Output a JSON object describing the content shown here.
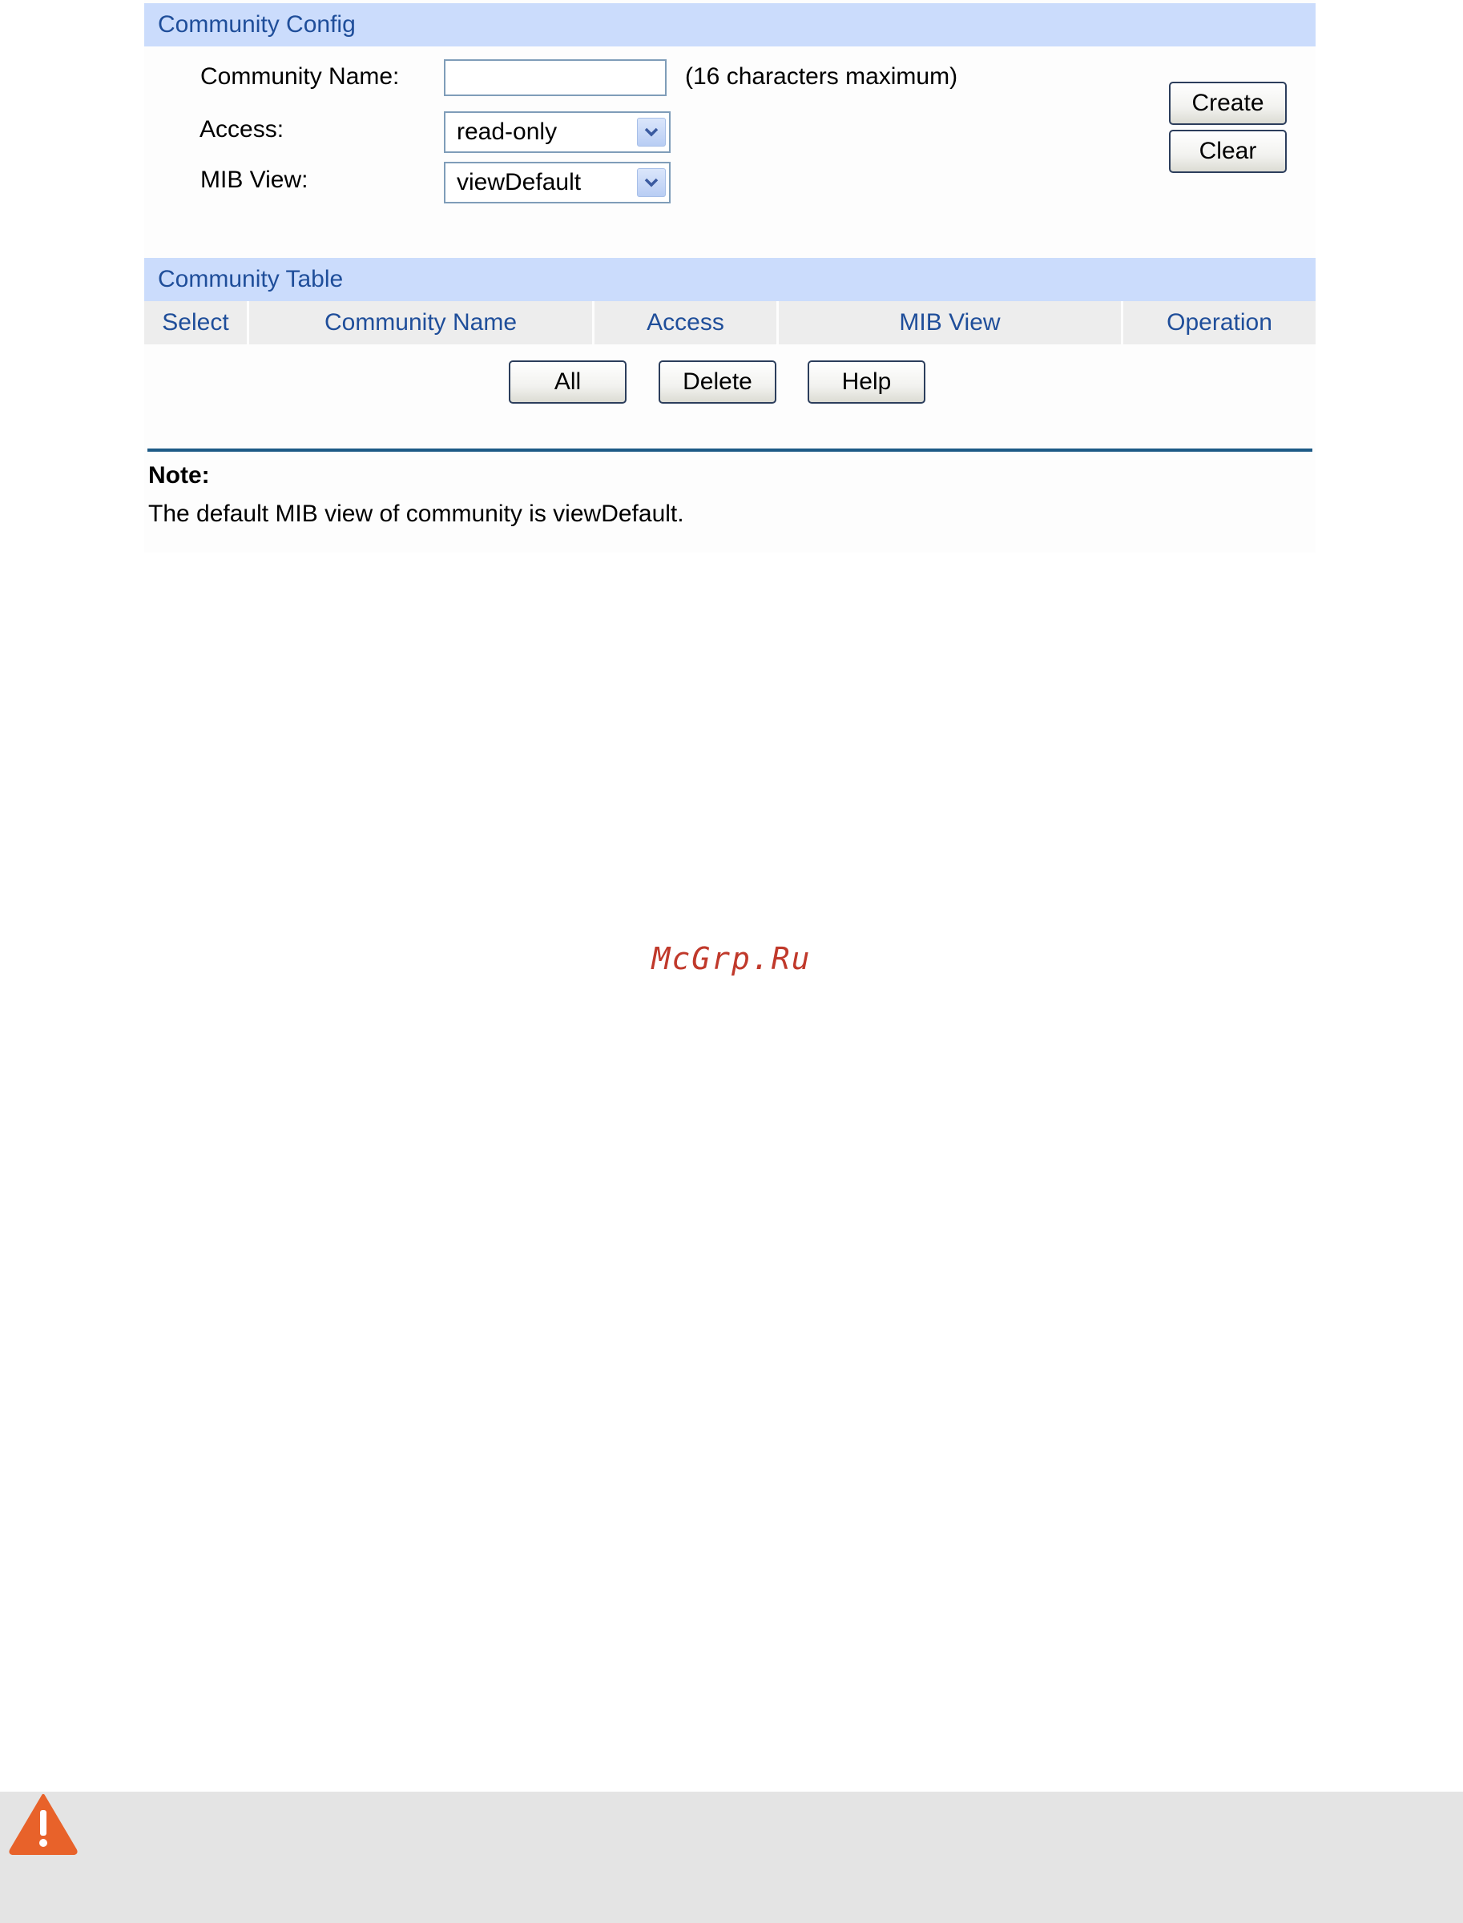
{
  "community_config": {
    "header": "Community Config",
    "name_label": "Community Name:",
    "name_value": "",
    "name_hint": "(16 characters maximum)",
    "access_label": "Access:",
    "access_value": "read-only",
    "mib_view_label": "MIB View:",
    "mib_view_value": "viewDefault",
    "create_label": "Create",
    "clear_label": "Clear"
  },
  "community_table": {
    "header": "Community Table",
    "columns": [
      "Select",
      "Community Name",
      "Access",
      "MIB View",
      "Operation"
    ],
    "buttons": {
      "all": "All",
      "delete": "Delete",
      "help": "Help"
    }
  },
  "note": {
    "title": "Note:",
    "text": "The default MIB view of community is viewDefault."
  },
  "watermark": "McGrp.Ru",
  "colors": {
    "header_bg": "#cbdcfc",
    "header_text": "#1f4e9a",
    "rule": "#1d5a86",
    "warning": "#e8622a"
  },
  "icons": {
    "warning": "warning-triangle-icon",
    "dropdown": "chevron-down-icon"
  }
}
